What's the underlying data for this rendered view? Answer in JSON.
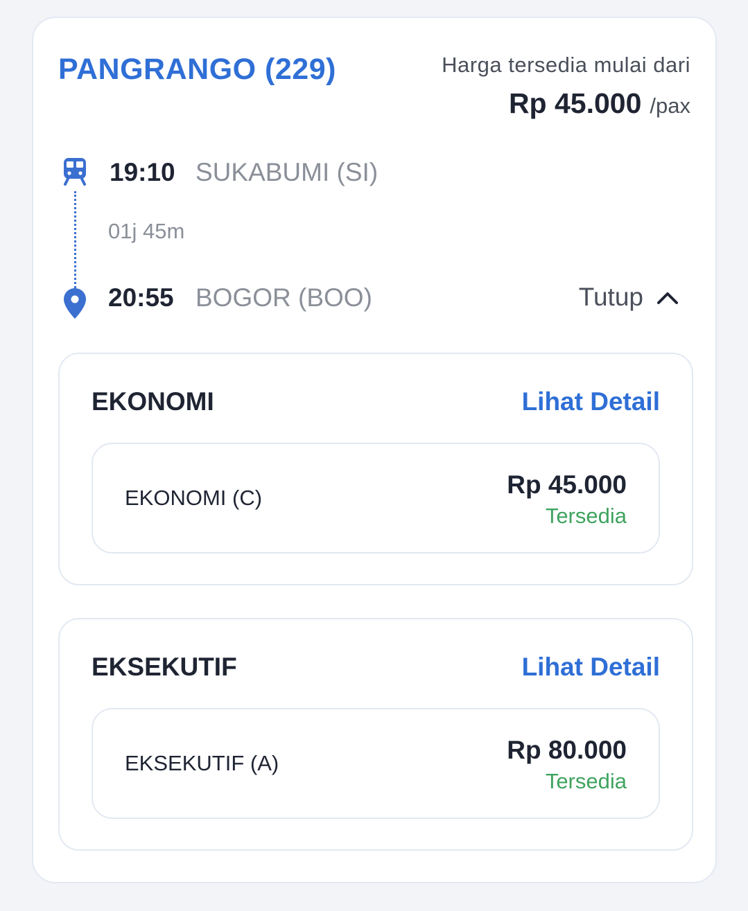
{
  "train": {
    "name": "PANGRANGO (229)",
    "price_caption": "Harga tersedia mulai dari",
    "price": "Rp 45.000",
    "price_unit": "/pax"
  },
  "route": {
    "departure": {
      "time": "19:10",
      "station": "SUKABUMI (SI)"
    },
    "duration": "01j 45m",
    "arrival": {
      "time": "20:55",
      "station": "BOGOR (BOO)"
    },
    "toggle_label": "Tutup"
  },
  "classes": [
    {
      "title": "EKONOMI",
      "detail_link": "Lihat Detail",
      "subclass": {
        "name": "EKONOMI (C)",
        "price": "Rp 45.000",
        "status": "Tersedia"
      }
    },
    {
      "title": "EKSEKUTIF",
      "detail_link": "Lihat Detail",
      "subclass": {
        "name": "EKSEKUTIF (A)",
        "price": "Rp 80.000",
        "status": "Tersedia"
      }
    }
  ],
  "icons": {
    "departure": "train-icon",
    "arrival": "location-pin-icon",
    "toggle": "chevron-up-icon"
  },
  "colors": {
    "accent": "#2f6fd6",
    "available": "#3fa35f",
    "text_dark": "#1f2433",
    "text_muted": "#8a8f98"
  }
}
